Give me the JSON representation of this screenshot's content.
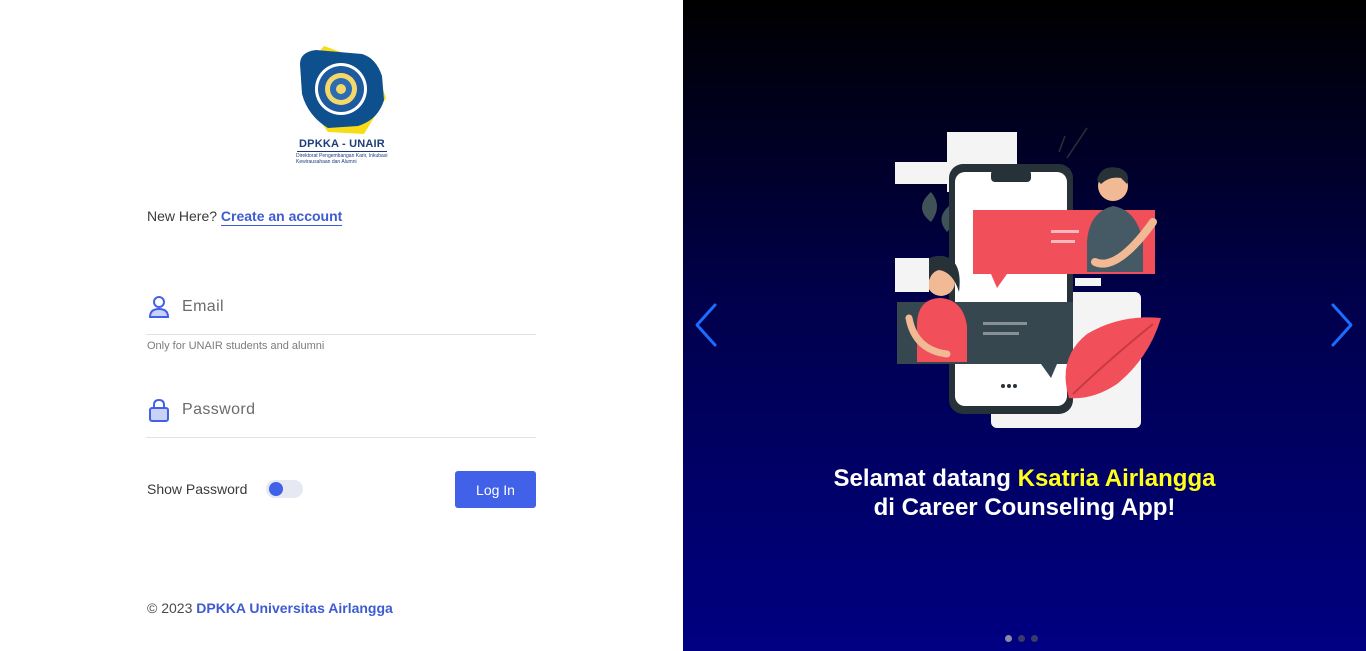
{
  "logo": {
    "title": "DPKKA - UNAIR",
    "subtitle": "Direktorat Pengembangan Karir, Inkubasi Kewirausahaan dan Alumni"
  },
  "signup": {
    "prompt": "New Here?",
    "link_label": "Create an account"
  },
  "form": {
    "email_placeholder": "Email",
    "email_helper": "Only for UNAIR students and alumni",
    "password_placeholder": "Password",
    "show_password_label": "Show Password",
    "show_password_on": false,
    "login_label": "Log In"
  },
  "footer": {
    "copyright": "© 2023",
    "org": "DPKKA Universitas Airlangga"
  },
  "carousel": {
    "headline_prefix": "Selamat datang",
    "headline_highlight": "Ksatria Airlangga",
    "headline_line2": "di Career Counseling App!",
    "active_slide": 1,
    "slide_count": 3
  },
  "colors": {
    "accent": "#4161e8",
    "highlight": "#ffff1a",
    "panel_bottom": "#000082"
  }
}
